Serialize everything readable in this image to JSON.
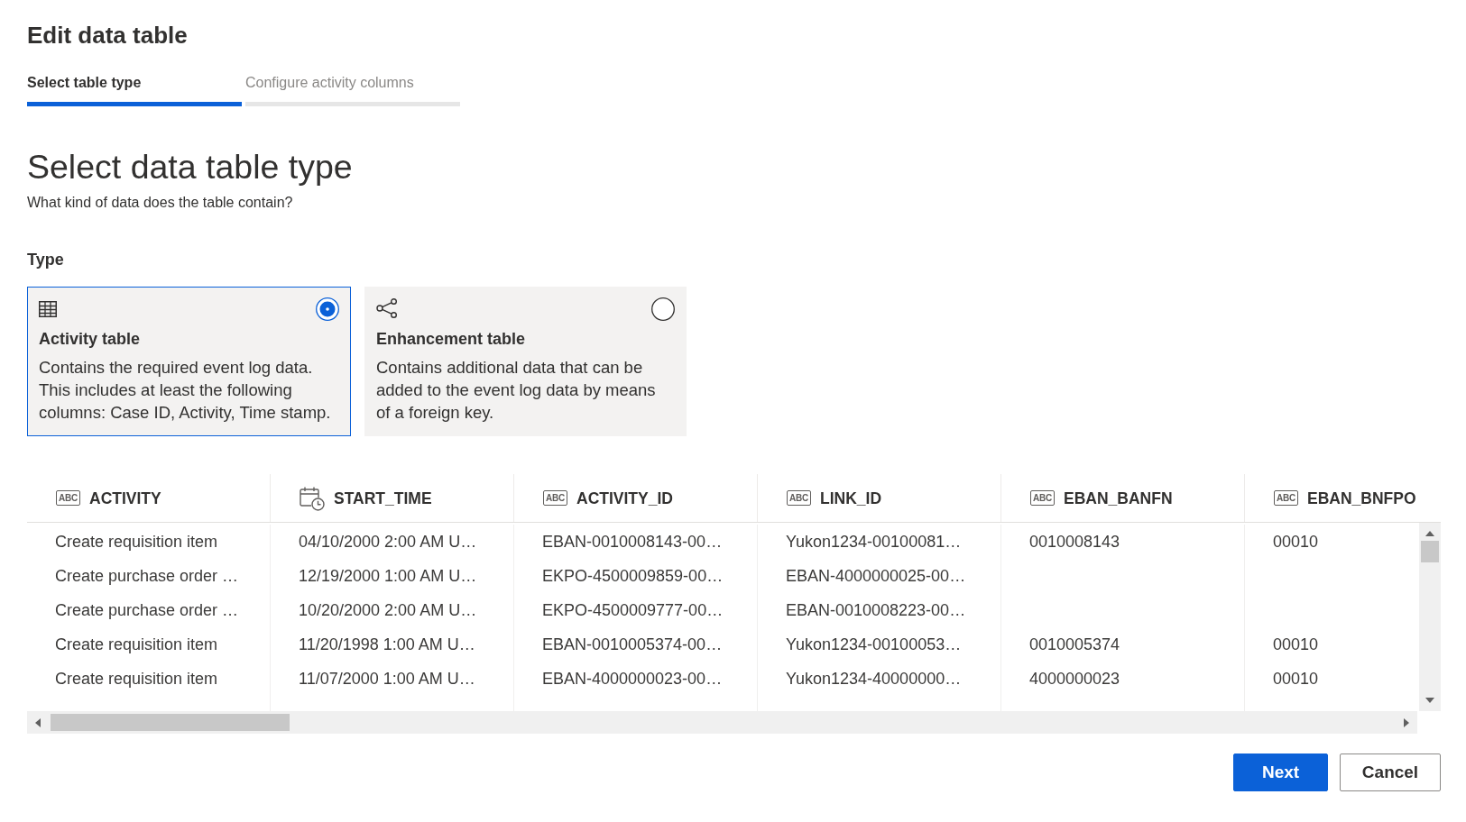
{
  "dialog": {
    "title": "Edit data table"
  },
  "steps": [
    {
      "label": "Select table type",
      "selected": true
    },
    {
      "label": "Configure activity columns",
      "selected": false
    }
  ],
  "heading": "Select data table type",
  "subheading": "What kind of data does the table contain?",
  "type_section": {
    "label": "Type",
    "options": [
      {
        "kind": "activity",
        "title": "Activity table",
        "description": "Contains the required event log data. This includes at least the following columns: Case ID, Activity, Time stamp.",
        "selected": true
      },
      {
        "kind": "enhancement",
        "title": "Enhancement table",
        "description": "Contains additional data that can be added to the event log data by means of a foreign key.",
        "selected": false
      }
    ]
  },
  "table": {
    "columns": [
      {
        "label": "ACTIVITY",
        "kind": "text",
        "type_badge": "ABC"
      },
      {
        "label": "START_TIME",
        "kind": "datetime"
      },
      {
        "label": "ACTIVITY_ID",
        "kind": "text",
        "type_badge": "ABC"
      },
      {
        "label": "LINK_ID",
        "kind": "text",
        "type_badge": "ABC"
      },
      {
        "label": "EBAN_BANFN",
        "kind": "text",
        "type_badge": "ABC"
      },
      {
        "label": "EBAN_BNFPO",
        "kind": "text",
        "type_badge": "ABC"
      }
    ],
    "rows": [
      [
        "Create requisition item",
        "04/10/2000 2:00 AM U…",
        "EBAN-0010008143-00…",
        "Yukon1234-00100081…",
        "0010008143",
        "00010"
      ],
      [
        "Create purchase order …",
        "12/19/2000 1:00 AM U…",
        "EKPO-4500009859-00…",
        "EBAN-4000000025-00…",
        null,
        null
      ],
      [
        "Create purchase order …",
        "10/20/2000 2:00 AM U…",
        "EKPO-4500009777-00…",
        "EBAN-0010008223-00…",
        null,
        null
      ],
      [
        "Create requisition item",
        "11/20/1998 1:00 AM U…",
        "EBAN-0010005374-00…",
        "Yukon1234-00100053…",
        "0010005374",
        "00010"
      ],
      [
        "Create requisition item",
        "11/07/2000 1:00 AM U…",
        "EBAN-4000000023-00…",
        "Yukon1234-40000000…",
        "4000000023",
        "00010"
      ]
    ]
  },
  "buttons": [
    {
      "label": "Next",
      "kind": "primary"
    },
    {
      "label": "Cancel",
      "kind": "secondary"
    }
  ]
}
